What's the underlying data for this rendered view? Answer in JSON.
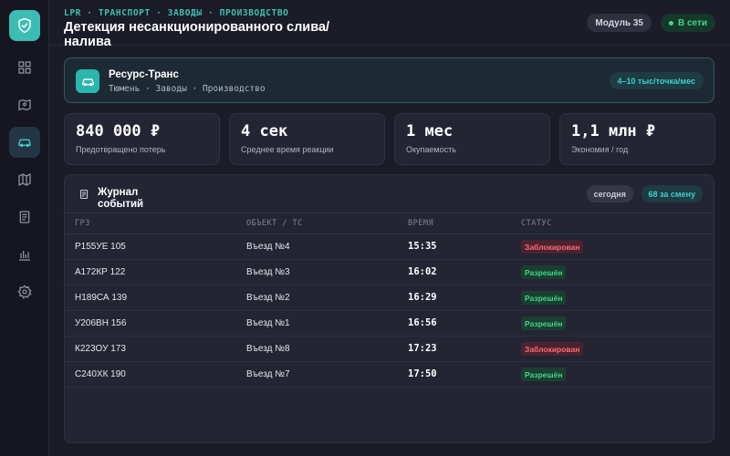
{
  "header": {
    "breadcrumb": "LPR · ТРАНСПОРТ · ЗАВОДЫ · ПРОИЗВОДСТВО",
    "title": "Детекция несанкционированного слива/ налива",
    "module_label": "Модуль 35",
    "status_label": "В сети"
  },
  "sidebar": {
    "items": [
      {
        "icon": "dashboard-icon"
      },
      {
        "icon": "map-pin-icon"
      },
      {
        "icon": "car-icon",
        "active": true
      },
      {
        "icon": "map-icon"
      },
      {
        "icon": "document-icon"
      },
      {
        "icon": "bar-chart-icon"
      },
      {
        "icon": "gear-icon"
      }
    ]
  },
  "company": {
    "name": "Ресурс-Транс",
    "location": "Тюмень · Заводы · Производство",
    "rate": "4–10 тыс/точка/мес"
  },
  "stats": [
    {
      "value": "840 000 ₽",
      "label": "Предотвращено потерь"
    },
    {
      "value": "4 сек",
      "label": "Среднее время реакции"
    },
    {
      "value": "1 мес",
      "label": "Окупаемость"
    },
    {
      "value": "1,1 млн ₽",
      "label": "Экономия / год"
    }
  ],
  "events": {
    "title": "Журнал событий",
    "filter_today": "сегодня",
    "shift_count": "68 за смену",
    "columns": [
      "ГРЗ",
      "ОБЪЕКТ / ТС",
      "ВРЕМЯ",
      "СТАТУС"
    ],
    "rows": [
      {
        "plate": "Р155УЕ 105",
        "object": "Въезд №4",
        "time": "15:35",
        "status": "Заблокирован",
        "state": "blocked"
      },
      {
        "plate": "А172КР 122",
        "object": "Въезд №3",
        "time": "16:02",
        "status": "Разрешён",
        "state": "allowed"
      },
      {
        "plate": "Н189СА 139",
        "object": "Въезд №2",
        "time": "16:29",
        "status": "Разрешён",
        "state": "allowed"
      },
      {
        "plate": "У206ВН 156",
        "object": "Въезд №1",
        "time": "16:56",
        "status": "Разрешён",
        "state": "allowed"
      },
      {
        "plate": "К223ОУ 173",
        "object": "Въезд №8",
        "time": "17:23",
        "status": "Заблокирован",
        "state": "blocked"
      },
      {
        "plate": "С240ХК 190",
        "object": "Въезд №7",
        "time": "17:50",
        "status": "Разрешён",
        "state": "allowed"
      }
    ]
  },
  "colors": {
    "accent": "#3cbdb3",
    "blocked": "#ff6b72",
    "allowed": "#3fd68a",
    "background": "#1b1c27"
  }
}
